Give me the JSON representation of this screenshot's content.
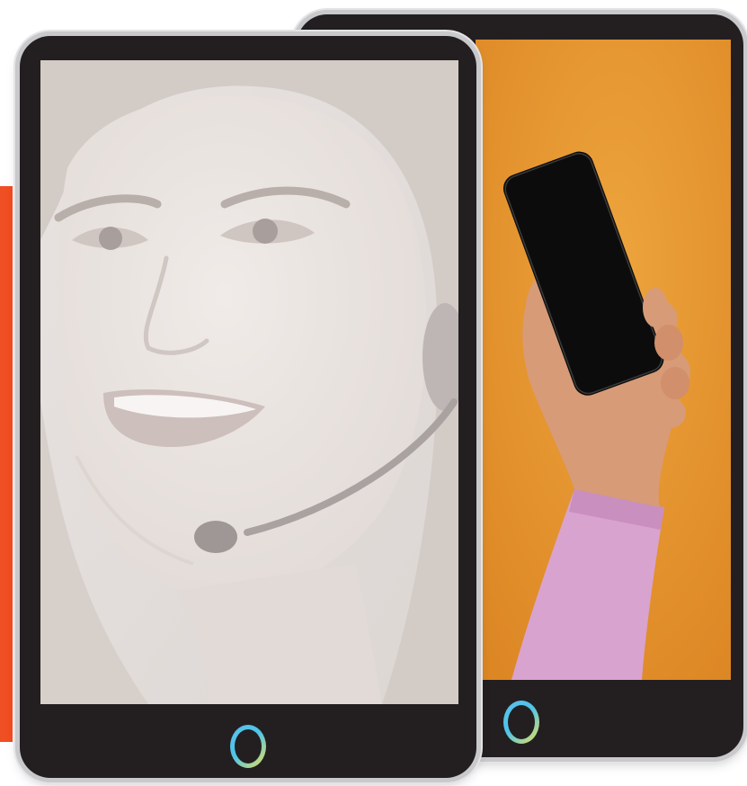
{
  "colors": {
    "accent_bar": "#f04e23",
    "tablet_frame": "#231f20",
    "orange_background": "#e58e27",
    "home_ring_blue": "#5bc0eb",
    "home_ring_yellow": "#e9e15a"
  },
  "scene": {
    "left_tablet": {
      "content": "smiling-woman-with-headset-photo"
    },
    "right_tablet": {
      "content": "hand-holding-smartphone-photo"
    }
  }
}
